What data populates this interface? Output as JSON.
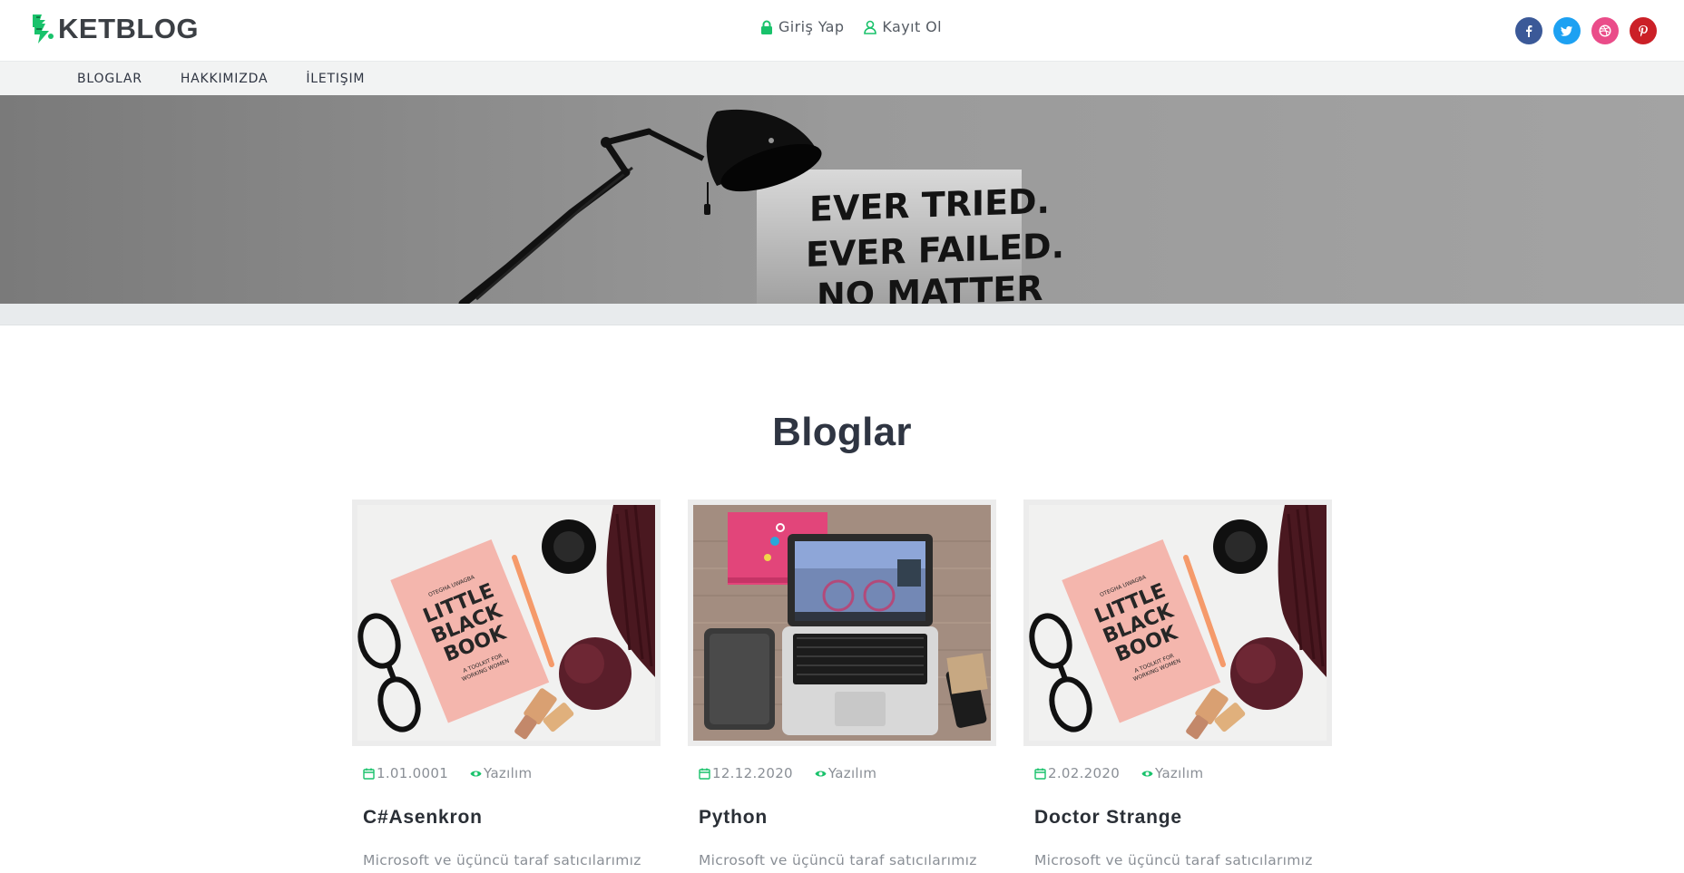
{
  "brand": {
    "name": "KETBLOG",
    "accent": "#19c26b"
  },
  "auth": {
    "login": "Giriş Yap",
    "register": "Kayıt Ol"
  },
  "social": [
    {
      "icon": "facebook-icon",
      "color": "#3b5998"
    },
    {
      "icon": "twitter-icon",
      "color": "#1da1f2"
    },
    {
      "icon": "dribbble-icon",
      "color": "#ea4c89"
    },
    {
      "icon": "pinterest-icon",
      "color": "#cb2027"
    }
  ],
  "nav": [
    "BLOGLAR",
    "HAKKIMIZDA",
    "İLETIŞIM"
  ],
  "hero": {
    "sign_lines": [
      "EVER TRIED.",
      "EVER FAILED.",
      "NO MATTER"
    ]
  },
  "section_title": "Bloglar",
  "posts": [
    {
      "date": "1.01.0001",
      "category": "Yazılım",
      "title": "C#Asenkron",
      "excerpt": "Microsoft ve üçüncü taraf satıcılarımız",
      "image": "book-flatlay",
      "book_lines": [
        "OTEGHA UWAGBA",
        "LITTLE",
        "BLACK",
        "BOOK",
        "A TOOLKIT FOR",
        "WORKING WOMEN"
      ]
    },
    {
      "date": "12.12.2020",
      "category": "Yazılım",
      "title": "Python",
      "excerpt": "Microsoft ve üçüncü taraf satıcılarımız",
      "image": "laptop-desk"
    },
    {
      "date": "2.02.2020",
      "category": "Yazılım",
      "title": "Doctor Strange",
      "excerpt": "Microsoft ve üçüncü taraf satıcılarımız",
      "image": "book-flatlay",
      "book_lines": [
        "OTEGHA UWAGBA",
        "LITTLE",
        "BLACK",
        "BOOK",
        "A TOOLKIT FOR",
        "WORKING WOMEN"
      ]
    }
  ]
}
